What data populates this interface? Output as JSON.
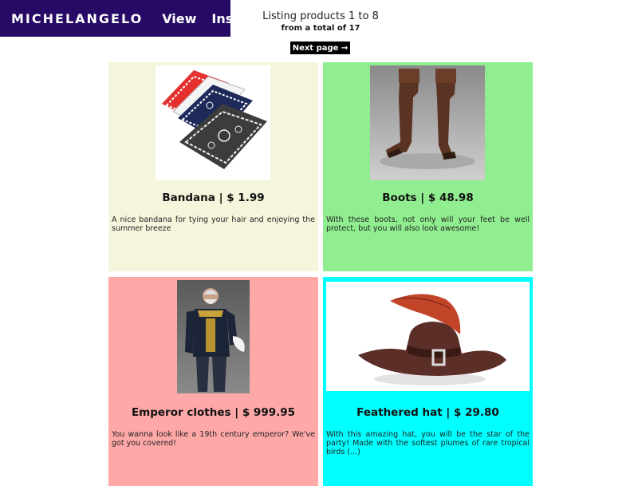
{
  "nav": {
    "brand": "MICHELANGELO",
    "view": "View",
    "insert": "Insert"
  },
  "listing": {
    "main": "Listing products 1 to 8",
    "sub_prefix": "from a total of ",
    "total": "17"
  },
  "next_button": "Next page →",
  "products": [
    {
      "title": "Bandana | $ 1.99",
      "description": "A nice bandana for tying your hair and enjoying the summer breeze",
      "image": "bandanas-image",
      "color": "#f5f5dc"
    },
    {
      "title": "Boots | $ 48.98",
      "description": "With these boots, not only will your feet be well protect, but you will also look awesome!",
      "image": "boots-image",
      "color": "#90ee90"
    },
    {
      "title": "Emperor clothes | $ 999.95",
      "description": "You wanna look like a 19th century emperor? We've got you covered!",
      "image": "emperor-image",
      "color": "#ffa8a8"
    },
    {
      "title": "Feathered hat | $ 29.80",
      "description": "With this amazing hat, you will be the star of the party! Made with the softest plumes of rare tropical birds (...)",
      "image": "feathered-hat-image",
      "color": "#00ffff"
    }
  ]
}
